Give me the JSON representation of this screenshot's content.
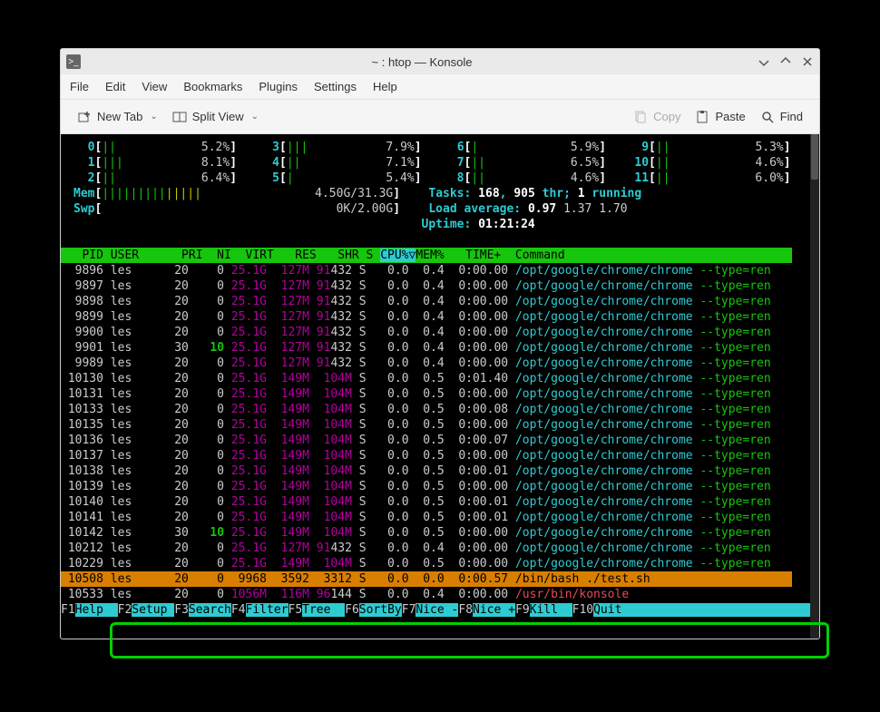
{
  "window": {
    "title": "~ : htop — Konsole"
  },
  "menubar": [
    "File",
    "Edit",
    "View",
    "Bookmarks",
    "Plugins",
    "Settings",
    "Help"
  ],
  "toolbar": {
    "new_tab": "New Tab",
    "split_view": "Split View",
    "copy": "Copy",
    "paste": "Paste",
    "find": "Find"
  },
  "cpus": [
    {
      "id": 0,
      "bar": "||",
      "pct": "5.2%"
    },
    {
      "id": 1,
      "bar": "|||",
      "pct": "8.1%"
    },
    {
      "id": 2,
      "bar": "||",
      "pct": "6.4%"
    },
    {
      "id": 3,
      "bar": "|||",
      "pct": "7.9%"
    },
    {
      "id": 4,
      "bar": "||",
      "pct": "7.1%"
    },
    {
      "id": 5,
      "bar": "|",
      "pct": "5.4%"
    },
    {
      "id": 6,
      "bar": "|",
      "pct": "5.9%"
    },
    {
      "id": 7,
      "bar": "||",
      "pct": "6.5%"
    },
    {
      "id": 8,
      "bar": "||",
      "pct": "4.6%"
    },
    {
      "id": 9,
      "bar": "||",
      "pct": "5.3%"
    },
    {
      "id": 10,
      "bar": "||",
      "pct": "4.6%"
    },
    {
      "id": 11,
      "bar": "||",
      "pct": "6.0%"
    }
  ],
  "mem": {
    "label": "Mem",
    "bar": "||||||||||||||",
    "value": "4.50G/31.3G"
  },
  "swp": {
    "label": "Swp",
    "bar": "",
    "value": "0K/2.00G"
  },
  "tasks": {
    "total": "168",
    "threads": "905",
    "running": "1"
  },
  "load": {
    "l1": "0.97",
    "l5": "1.37",
    "l15": "1.70"
  },
  "uptime": "01:21:24",
  "columns": "   PID USER      PRI  NI  VIRT   RES   SHR S CPU%▽MEM%   TIME+  Command",
  "processes": [
    {
      "pid": " 9896",
      "user": "les  ",
      "pri": "20",
      "ni": "  0",
      "virt": "25.1G",
      "res": " 127M",
      "shr_a": "91",
      "shr_b": "432",
      "s": "S",
      "cpu": "0.0",
      "mem": "0.4",
      "time": "0:00.00",
      "cmd": "/opt/google/chrome/chrome --type=ren"
    },
    {
      "pid": " 9897",
      "user": "les  ",
      "pri": "20",
      "ni": "  0",
      "virt": "25.1G",
      "res": " 127M",
      "shr_a": "91",
      "shr_b": "432",
      "s": "S",
      "cpu": "0.0",
      "mem": "0.4",
      "time": "0:00.00",
      "cmd": "/opt/google/chrome/chrome --type=ren"
    },
    {
      "pid": " 9898",
      "user": "les  ",
      "pri": "20",
      "ni": "  0",
      "virt": "25.1G",
      "res": " 127M",
      "shr_a": "91",
      "shr_b": "432",
      "s": "S",
      "cpu": "0.0",
      "mem": "0.4",
      "time": "0:00.00",
      "cmd": "/opt/google/chrome/chrome --type=ren"
    },
    {
      "pid": " 9899",
      "user": "les  ",
      "pri": "20",
      "ni": "  0",
      "virt": "25.1G",
      "res": " 127M",
      "shr_a": "91",
      "shr_b": "432",
      "s": "S",
      "cpu": "0.0",
      "mem": "0.4",
      "time": "0:00.00",
      "cmd": "/opt/google/chrome/chrome --type=ren"
    },
    {
      "pid": " 9900",
      "user": "les  ",
      "pri": "20",
      "ni": "  0",
      "virt": "25.1G",
      "res": " 127M",
      "shr_a": "91",
      "shr_b": "432",
      "s": "S",
      "cpu": "0.0",
      "mem": "0.4",
      "time": "0:00.00",
      "cmd": "/opt/google/chrome/chrome --type=ren"
    },
    {
      "pid": " 9901",
      "user": "les  ",
      "pri": "30",
      "ni": " 10",
      "virt": "25.1G",
      "res": " 127M",
      "shr_a": "91",
      "shr_b": "432",
      "s": "S",
      "cpu": "0.0",
      "mem": "0.4",
      "time": "0:00.00",
      "cmd": "/opt/google/chrome/chrome --type=ren",
      "ni_green": true
    },
    {
      "pid": " 9989",
      "user": "les  ",
      "pri": "20",
      "ni": "  0",
      "virt": "25.1G",
      "res": " 127M",
      "shr_a": "91",
      "shr_b": "432",
      "s": "S",
      "cpu": "0.0",
      "mem": "0.4",
      "time": "0:00.00",
      "cmd": "/opt/google/chrome/chrome --type=ren"
    },
    {
      "pid": "10130",
      "user": "les  ",
      "pri": "20",
      "ni": "  0",
      "virt": "25.1G",
      "res": " 149M",
      "shr_a": "",
      "shr_b": " 104M",
      "s": "S",
      "cpu": "0.0",
      "mem": "0.5",
      "time": "0:01.40",
      "cmd": "/opt/google/chrome/chrome --type=ren"
    },
    {
      "pid": "10131",
      "user": "les  ",
      "pri": "20",
      "ni": "  0",
      "virt": "25.1G",
      "res": " 149M",
      "shr_a": "",
      "shr_b": " 104M",
      "s": "S",
      "cpu": "0.0",
      "mem": "0.5",
      "time": "0:00.00",
      "cmd": "/opt/google/chrome/chrome --type=ren"
    },
    {
      "pid": "10133",
      "user": "les  ",
      "pri": "20",
      "ni": "  0",
      "virt": "25.1G",
      "res": " 149M",
      "shr_a": "",
      "shr_b": " 104M",
      "s": "S",
      "cpu": "0.0",
      "mem": "0.5",
      "time": "0:00.08",
      "cmd": "/opt/google/chrome/chrome --type=ren"
    },
    {
      "pid": "10135",
      "user": "les  ",
      "pri": "20",
      "ni": "  0",
      "virt": "25.1G",
      "res": " 149M",
      "shr_a": "",
      "shr_b": " 104M",
      "s": "S",
      "cpu": "0.0",
      "mem": "0.5",
      "time": "0:00.00",
      "cmd": "/opt/google/chrome/chrome --type=ren"
    },
    {
      "pid": "10136",
      "user": "les  ",
      "pri": "20",
      "ni": "  0",
      "virt": "25.1G",
      "res": " 149M",
      "shr_a": "",
      "shr_b": " 104M",
      "s": "S",
      "cpu": "0.0",
      "mem": "0.5",
      "time": "0:00.07",
      "cmd": "/opt/google/chrome/chrome --type=ren"
    },
    {
      "pid": "10137",
      "user": "les  ",
      "pri": "20",
      "ni": "  0",
      "virt": "25.1G",
      "res": " 149M",
      "shr_a": "",
      "shr_b": " 104M",
      "s": "S",
      "cpu": "0.0",
      "mem": "0.5",
      "time": "0:00.00",
      "cmd": "/opt/google/chrome/chrome --type=ren"
    },
    {
      "pid": "10138",
      "user": "les  ",
      "pri": "20",
      "ni": "  0",
      "virt": "25.1G",
      "res": " 149M",
      "shr_a": "",
      "shr_b": " 104M",
      "s": "S",
      "cpu": "0.0",
      "mem": "0.5",
      "time": "0:00.01",
      "cmd": "/opt/google/chrome/chrome --type=ren"
    },
    {
      "pid": "10139",
      "user": "les  ",
      "pri": "20",
      "ni": "  0",
      "virt": "25.1G",
      "res": " 149M",
      "shr_a": "",
      "shr_b": " 104M",
      "s": "S",
      "cpu": "0.0",
      "mem": "0.5",
      "time": "0:00.00",
      "cmd": "/opt/google/chrome/chrome --type=ren"
    },
    {
      "pid": "10140",
      "user": "les  ",
      "pri": "20",
      "ni": "  0",
      "virt": "25.1G",
      "res": " 149M",
      "shr_a": "",
      "shr_b": " 104M",
      "s": "S",
      "cpu": "0.0",
      "mem": "0.5",
      "time": "0:00.01",
      "cmd": "/opt/google/chrome/chrome --type=ren"
    },
    {
      "pid": "10141",
      "user": "les  ",
      "pri": "20",
      "ni": "  0",
      "virt": "25.1G",
      "res": " 149M",
      "shr_a": "",
      "shr_b": " 104M",
      "s": "S",
      "cpu": "0.0",
      "mem": "0.5",
      "time": "0:00.01",
      "cmd": "/opt/google/chrome/chrome --type=ren"
    },
    {
      "pid": "10142",
      "user": "les  ",
      "pri": "30",
      "ni": " 10",
      "virt": "25.1G",
      "res": " 149M",
      "shr_a": "",
      "shr_b": " 104M",
      "s": "S",
      "cpu": "0.0",
      "mem": "0.5",
      "time": "0:00.00",
      "cmd": "/opt/google/chrome/chrome --type=ren",
      "ni_green": true
    },
    {
      "pid": "10212",
      "user": "les  ",
      "pri": "20",
      "ni": "  0",
      "virt": "25.1G",
      "res": " 127M",
      "shr_a": "91",
      "shr_b": "432",
      "s": "S",
      "cpu": "0.0",
      "mem": "0.4",
      "time": "0:00.00",
      "cmd": "/opt/google/chrome/chrome --type=ren"
    },
    {
      "pid": "10229",
      "user": "les  ",
      "pri": "20",
      "ni": "  0",
      "virt": "25.1G",
      "res": " 149M",
      "shr_a": "",
      "shr_b": " 104M",
      "s": "S",
      "cpu": "0.0",
      "mem": "0.5",
      "time": "0:00.00",
      "cmd": "/opt/google/chrome/chrome --type=ren"
    },
    {
      "pid": "10508",
      "user": "les  ",
      "pri": "20",
      "ni": "  0",
      "virt": " 9968",
      "res": " 3592",
      "shr_a": "",
      "shr_b": " 3312",
      "s": "S",
      "cpu": "0.0",
      "mem": "0.0",
      "time": "0:00.57",
      "cmd": "/bin/bash ./test.sh",
      "selected": true
    },
    {
      "pid": "10533",
      "user": "les  ",
      "pri": "20",
      "ni": "  0",
      "virt": "1056M",
      "res": " 116M",
      "shr_a": "96",
      "shr_b": "144",
      "s": "S",
      "cpu": "0.0",
      "mem": "0.4",
      "time": "0:00.00",
      "cmd": "/usr/bin/konsole",
      "usr": true
    }
  ],
  "fkeys": [
    {
      "key": "F1",
      "label": "Help  "
    },
    {
      "key": "F2",
      "label": "Setup "
    },
    {
      "key": "F3",
      "label": "Search"
    },
    {
      "key": "F4",
      "label": "Filter"
    },
    {
      "key": "F5",
      "label": "Tree  "
    },
    {
      "key": "F6",
      "label": "SortBy"
    },
    {
      "key": "F7",
      "label": "Nice -"
    },
    {
      "key": "F8",
      "label": "Nice +"
    },
    {
      "key": "F9",
      "label": "Kill  "
    },
    {
      "key": "F10",
      "label": "Quit  "
    }
  ]
}
